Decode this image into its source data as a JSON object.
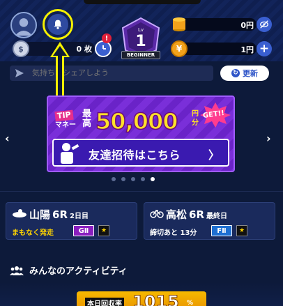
{
  "header": {
    "coins": "0 枚",
    "clock_badge": "!",
    "level_label": "Lv",
    "level_value": "1",
    "level_rank": "BEGINNER",
    "balance_1": "0円",
    "balance_2": "1円",
    "plus_label": "+",
    "coin_symbol": "$",
    "yen_symbol": "¥"
  },
  "message_bar": {
    "placeholder": "気持ちをシェアしよう",
    "update_label": "更新",
    "update_icon": "refresh-icon"
  },
  "banner": {
    "tip_label": "TIP",
    "money_label": "マネー",
    "max_label": "最高",
    "amount": "50,000",
    "unit": "円分",
    "get_label": "GET!!",
    "invite_label": "友達招待はこちら",
    "invite_arrow": "〉"
  },
  "carousel": {
    "prev": "‹",
    "next": "›",
    "dots": 5,
    "active_index": 4
  },
  "races": [
    {
      "venue": "山陽",
      "race": "6R",
      "day": "2日目",
      "status": "まもなく発走",
      "status_color": "#ffd400",
      "grade": "GⅡ",
      "grade_color": "#8a1fbf",
      "icon": "autorace-icon"
    },
    {
      "venue": "高松",
      "race": "6R",
      "day": "最終日",
      "status": "締切あと 13分",
      "status_color": "#ffffff",
      "grade": "FⅡ",
      "grade_color": "#1f6fd1",
      "icon": "bicycle-icon"
    }
  ],
  "activity": {
    "heading": "みんなのアクティビティ",
    "rate_label": "本日回収率",
    "rate_value": "1015",
    "rate_unit": "%"
  },
  "colors": {
    "background": "#0d1a3a",
    "accent_blue": "#3a5fd0",
    "highlight_yellow": "#f5f000"
  }
}
